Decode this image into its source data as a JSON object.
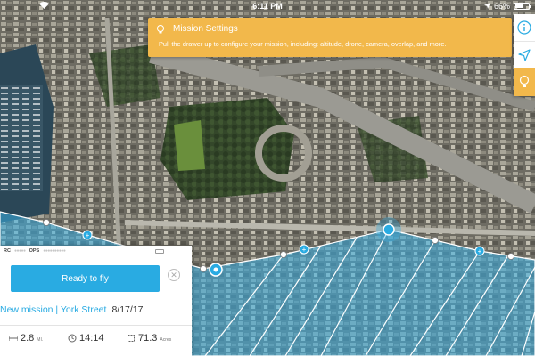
{
  "status_bar": {
    "time": "6:11 PM",
    "battery_percent": "66%",
    "battery_level": 0.66
  },
  "banner": {
    "title": "Mission Settings",
    "body": "Pull the drawer up to configure your mission, including: altitude, drone, camera, overlap, and more.",
    "color": "#f2b84b"
  },
  "toolbar": {
    "tools": [
      "info-icon",
      "navigation-arrow-icon",
      "lightbulb-icon"
    ]
  },
  "panel": {
    "rc_label": "RC",
    "ops_label": "OPS",
    "ready_label": "Ready to fly",
    "mission_name": "New mission | York Street",
    "mission_date": "8/17/17",
    "stats": {
      "distance_value": "2.8",
      "distance_unit": "MI.",
      "time_value": "14:14",
      "area_value": "71.3",
      "area_unit": "Acres"
    }
  },
  "colors": {
    "accent": "#29abe2",
    "coverage": "#3ab0e6"
  }
}
